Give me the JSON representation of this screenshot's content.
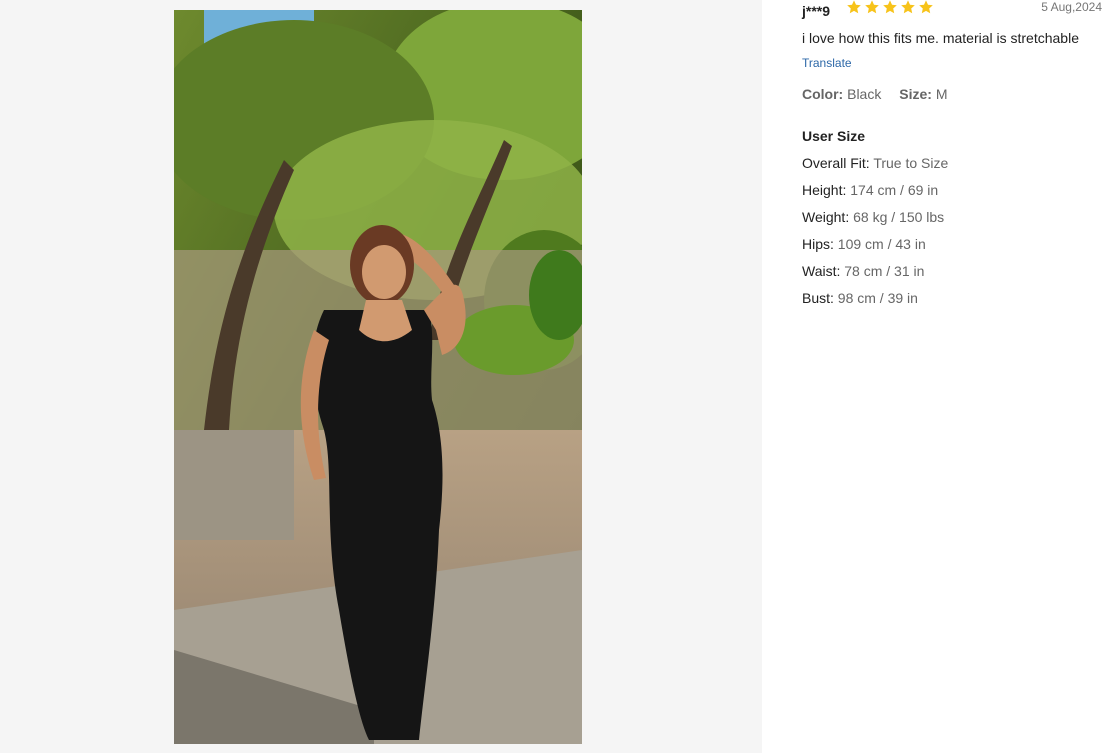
{
  "review": {
    "reviewer": "j***9",
    "rating": 5,
    "rating_max": 5,
    "star_color": "#f7c31a",
    "date": "5 Aug,2024",
    "comment": "i love how this fits me. material is stretchable",
    "translate_label": "Translate",
    "attributes": {
      "color_label": "Color:",
      "color_value": "Black",
      "size_label": "Size:",
      "size_value": "M"
    },
    "user_size": {
      "title": "User Size",
      "items": [
        {
          "label": "Overall Fit:",
          "value": "True to Size"
        },
        {
          "label": "Height:",
          "value": "174 cm / 69 in"
        },
        {
          "label": "Weight:",
          "value": "68 kg / 150 lbs"
        },
        {
          "label": "Hips:",
          "value": "109 cm / 43 in"
        },
        {
          "label": "Waist:",
          "value": "78 cm / 31 in"
        },
        {
          "label": "Bust:",
          "value": "98 cm / 39 in"
        }
      ]
    }
  },
  "gallery": {
    "photo_icon": "review-photo"
  },
  "colors": {
    "gallery_bg": "#f5f5f5",
    "link": "#2d68a8",
    "muted": "#666666"
  }
}
